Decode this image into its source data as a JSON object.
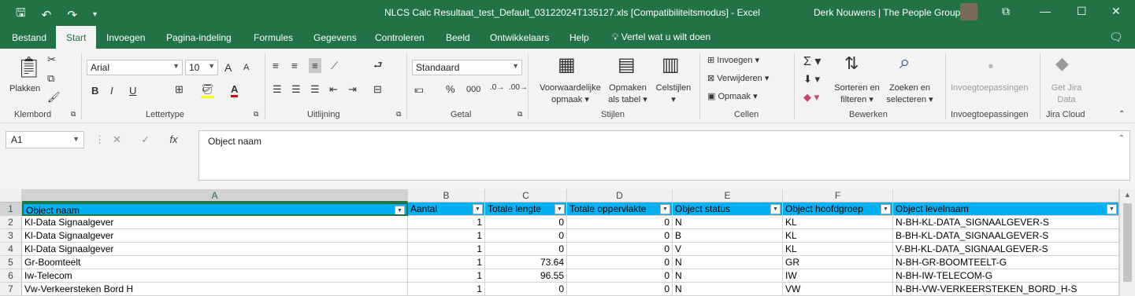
{
  "window": {
    "title": "NLCS Calc Resultaat_test_Default_03122024T135127.xls  [Compatibiliteitsmodus]  -  Excel",
    "user": "Derk Nouwens | The People Group"
  },
  "tabs": [
    "Bestand",
    "Start",
    "Invoegen",
    "Pagina-indeling",
    "Formules",
    "Gegevens",
    "Controleren",
    "Beeld",
    "Ontwikkelaars",
    "Help"
  ],
  "tell_me": "Vertel wat u wilt doen",
  "ribbon": {
    "clipboard": {
      "paste": "Plakken",
      "label": "Klembord"
    },
    "font": {
      "name": "Arial",
      "size": "10",
      "bold": "B",
      "italic": "I",
      "underline": "U",
      "grow": "A",
      "shrink": "A",
      "label": "Lettertype"
    },
    "alignment": {
      "label": "Uitlijning"
    },
    "number": {
      "format": "Standaard",
      "percent": "%",
      "label": "Getal"
    },
    "styles": {
      "conditional_1": "Voorwaardelijke",
      "conditional_2": "opmaak",
      "table_1": "Opmaken",
      "table_2": "als tabel",
      "cell_styles": "Celstijlen",
      "label": "Stijlen"
    },
    "cells": {
      "insert": "Invoegen",
      "delete": "Verwijderen",
      "format": "Opmaak",
      "label": "Cellen"
    },
    "editing": {
      "sort_1": "Sorteren en",
      "sort_2": "filteren",
      "find_1": "Zoeken en",
      "find_2": "selecteren",
      "label": "Bewerken"
    },
    "addins": {
      "button": "Invoegtoepassingen",
      "label": "Invoegtoepassingen"
    },
    "jira": {
      "button_1": "Get Jira",
      "button_2": "Data",
      "label": "Jira Cloud"
    }
  },
  "formula_bar": {
    "name_box": "A1",
    "fx": "fx",
    "cancel": "✕",
    "enter": "✓",
    "content": "Object naam"
  },
  "grid": {
    "columns": [
      "A",
      "B",
      "C",
      "D",
      "E",
      "F"
    ],
    "row_numbers": [
      "1",
      "2",
      "3",
      "4",
      "5",
      "6",
      "7"
    ],
    "header": [
      "Object naam",
      "Aantal",
      "Totale lengte",
      "Totale oppervlakte",
      "Object status",
      "Object hoofdgroep",
      "Object levelnaam"
    ],
    "rows": [
      [
        "Kl-Data Signaalgever",
        "1",
        "0",
        "0",
        "N",
        "KL",
        "N-BH-KL-DATA_SIGNAALGEVER-S"
      ],
      [
        "Kl-Data Signaalgever",
        "1",
        "0",
        "0",
        "B",
        "KL",
        "B-BH-KL-DATA_SIGNAALGEVER-S"
      ],
      [
        "Kl-Data Signaalgever",
        "1",
        "0",
        "0",
        "V",
        "KL",
        "V-BH-KL-DATA_SIGNAALGEVER-S"
      ],
      [
        "Gr-Boomteelt",
        "1",
        "73.64",
        "0",
        "N",
        "GR",
        "N-BH-GR-BOOMTEELT-G"
      ],
      [
        "Iw-Telecom",
        "1",
        "96.55",
        "0",
        "N",
        "IW",
        "N-BH-IW-TELECOM-G"
      ],
      [
        "Vw-Verkeersteken Bord H",
        "1",
        "0",
        "0",
        "N",
        "VW",
        "N-BH-VW-VERKEERSTEKEN_BORD_H-S"
      ]
    ]
  },
  "colors": {
    "excel_green": "#217346",
    "header_fill": "#00b0f0",
    "ribbon_bg": "#f3f3f3"
  }
}
